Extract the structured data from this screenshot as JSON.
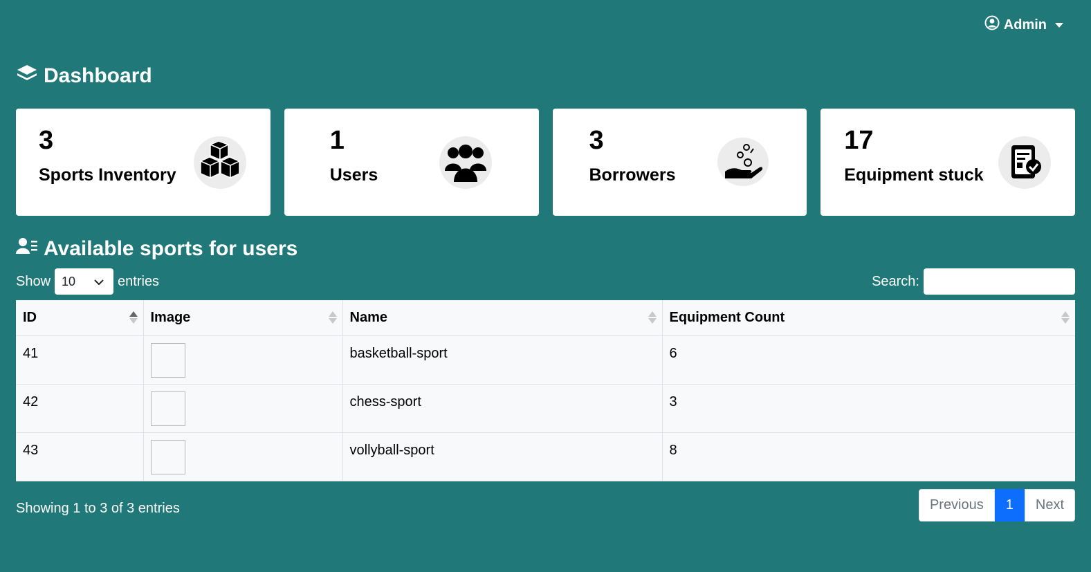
{
  "user_menu": {
    "label": "Admin"
  },
  "dashboard": {
    "title": "Dashboard"
  },
  "cards": [
    {
      "count": "3",
      "label": "Sports Inventory",
      "icon": "boxes-icon"
    },
    {
      "count": "1",
      "label": "Users",
      "icon": "users-group-icon"
    },
    {
      "count": "3",
      "label": "Borrowers",
      "icon": "hand-coins-icon"
    },
    {
      "count": "17",
      "label": "Equipment stuck",
      "icon": "document-check-icon"
    }
  ],
  "section": {
    "title": "Available sports for users"
  },
  "controls": {
    "show_label": "Show",
    "entries_value": "10",
    "entries_label": "entries",
    "search_label": "Search:",
    "search_value": ""
  },
  "table": {
    "headers": [
      "ID",
      "Image",
      "Name",
      "Equipment Count"
    ],
    "rows": [
      {
        "id": "41",
        "name": "basketball-sport",
        "count": "6"
      },
      {
        "id": "42",
        "name": "chess-sport",
        "count": "3"
      },
      {
        "id": "43",
        "name": "vollyball-sport",
        "count": "8"
      }
    ]
  },
  "footer": {
    "info": "Showing 1 to 3 of 3 entries",
    "prev": "Previous",
    "page": "1",
    "next": "Next"
  },
  "colors": {
    "background": "#207878",
    "page_active": "#0d6efd"
  }
}
